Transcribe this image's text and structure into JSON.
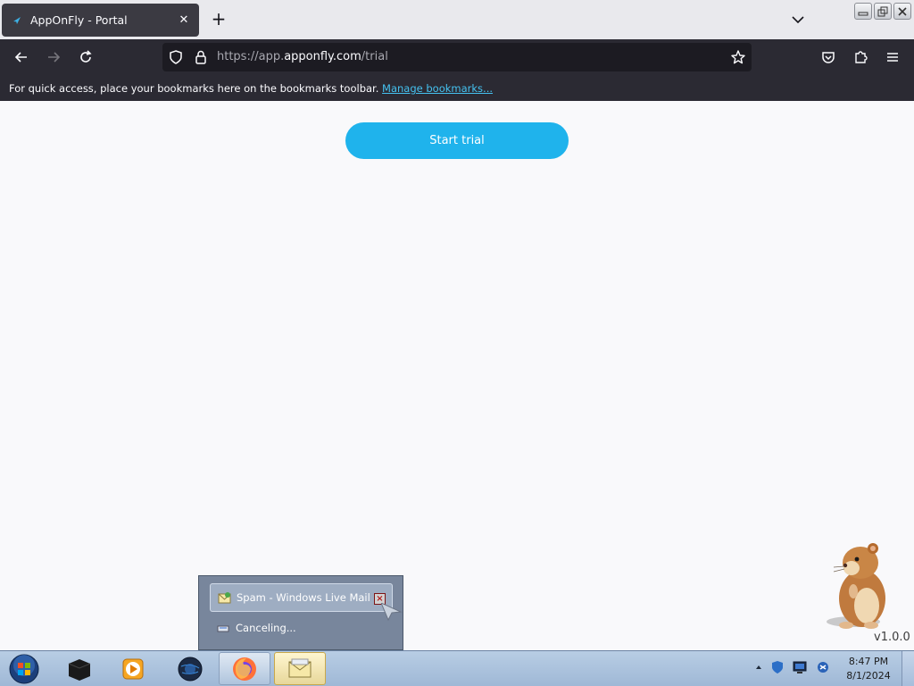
{
  "browser": {
    "tab": {
      "title": "AppOnFly - Portal",
      "close_glyph": "✕"
    },
    "new_tab_glyph": "+",
    "url": {
      "prefix": "https://app.",
      "domain": "apponfly.com",
      "path": "/trial"
    },
    "bookmarks_bar": {
      "text": "For quick access, place your bookmarks here on the bookmarks toolbar.",
      "link": "Manage bookmarks..."
    }
  },
  "page": {
    "start_button": "Start trial",
    "start_button_color": "#1fb3ec"
  },
  "gadget": {
    "version": "v1.0.0",
    "icon": "hamster"
  },
  "popup": {
    "item1": "Spam - Windows Live Mail",
    "item2": "Canceling..."
  },
  "taskbar": {
    "items": [
      "start-orb",
      "terminal",
      "media-player",
      "globe",
      "firefox",
      "windows-live-mail"
    ],
    "clock": {
      "time": "8:47 PM",
      "date": "8/1/2024"
    }
  }
}
